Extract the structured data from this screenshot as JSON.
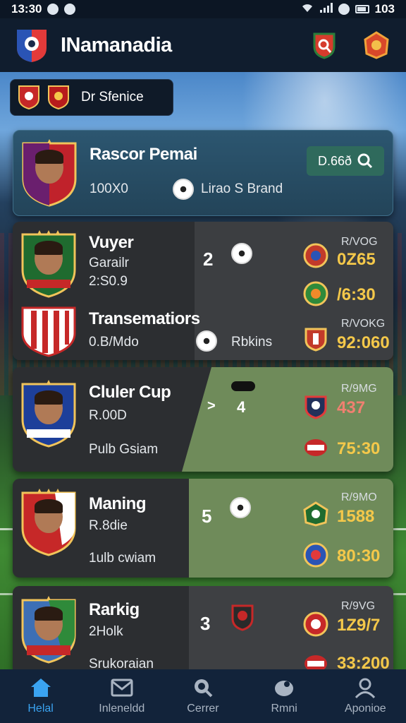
{
  "status_bar": {
    "time": "13:30",
    "battery": "103"
  },
  "app_bar": {
    "title": "INamanadia"
  },
  "filter": {
    "label": "Dr Sfenice"
  },
  "featured": {
    "name": "Rascor Pemai",
    "stat": "100X0",
    "club": "Lirao S Brand",
    "action": "D.66ð"
  },
  "matches": [
    {
      "rows": [
        {
          "title": "Vuyer",
          "sub1": "Garailr",
          "sub2": "2:S0.9",
          "score": "2",
          "label": "R/VOG",
          "value": "0Z65"
        },
        {
          "title": "",
          "sub1": "",
          "sub2": "",
          "score": "",
          "label": "",
          "value": "/6:30"
        }
      ]
    },
    {
      "rows": [
        {
          "title": "Transematiors",
          "sub1": "0.B/Mdo",
          "extra": "Rbkins",
          "label": "R/VOKG",
          "value": "92:060"
        }
      ]
    },
    {
      "rows": [
        {
          "title": "Cluler Cup",
          "sub1": "R.00D",
          "sub2": "Pulb Gsiam",
          "score": "4",
          "label": "R/9MG",
          "value": "437",
          "value2": "75:30"
        }
      ]
    },
    {
      "rows": [
        {
          "title": "Maning",
          "sub1": "R.8die",
          "sub2": "1ulb cwiam",
          "score": "5",
          "label": "R/9MO",
          "value": "1588",
          "value2": "80:30"
        }
      ]
    },
    {
      "rows": [
        {
          "title": "Rarkig",
          "sub1": "2Holk",
          "sub2": "Srukoraian",
          "score": "3",
          "label": "R/9VG",
          "value": "1Z9/7",
          "value2": "33:200"
        }
      ]
    }
  ],
  "bottom_nav": [
    {
      "label": "Helal",
      "icon": "home-icon"
    },
    {
      "label": "Inleneldd",
      "icon": "mail-icon"
    },
    {
      "label": "Cerrer",
      "icon": "search-icon"
    },
    {
      "label": "Rmni",
      "icon": "ball-icon"
    },
    {
      "label": "Aponioe",
      "icon": "profile-icon"
    }
  ],
  "colors": {
    "accent_blue": "#3aa3f0",
    "time_yellow": "#f4c84a",
    "time_red": "#f08070",
    "panel_green": "#6f8b5a",
    "featured_teal": "#2c5670"
  }
}
